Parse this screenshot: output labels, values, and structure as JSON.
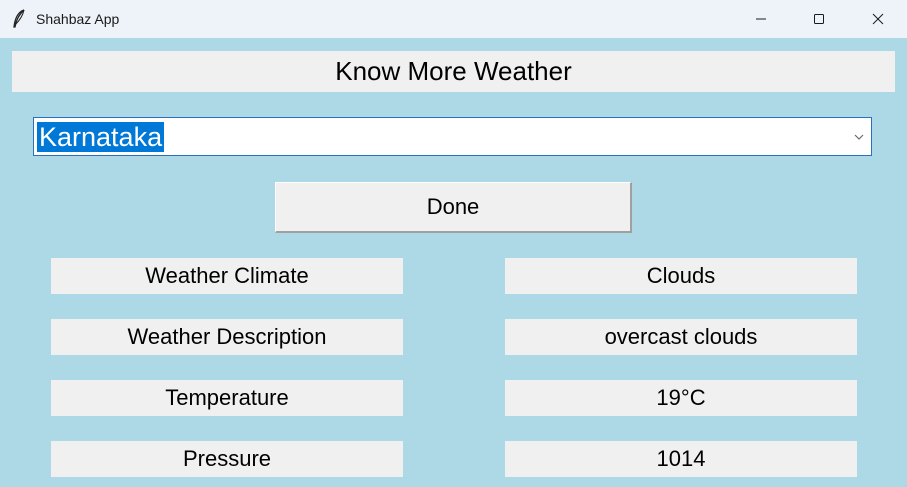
{
  "window": {
    "title": "Shahbaz App",
    "icon": "feather-icon",
    "controls": [
      "minimize-icon",
      "maximize-icon",
      "close-icon"
    ]
  },
  "header": {
    "title": "Know More Weather"
  },
  "location_select": {
    "selected_value": "Karnataka",
    "arrow_icon": "chevron-down-icon"
  },
  "actions": {
    "done_label": "Done"
  },
  "weather": {
    "climate_label": "Weather Climate",
    "climate_value": "Clouds",
    "description_label": "Weather Description",
    "description_value": "overcast clouds",
    "temperature_label": "Temperature",
    "temperature_value": "19°C",
    "pressure_label": "Pressure",
    "pressure_value": "1014"
  },
  "colors": {
    "background": "#add8e6",
    "label_background": "#f0f0f0",
    "selection_highlight": "#0078d7"
  }
}
